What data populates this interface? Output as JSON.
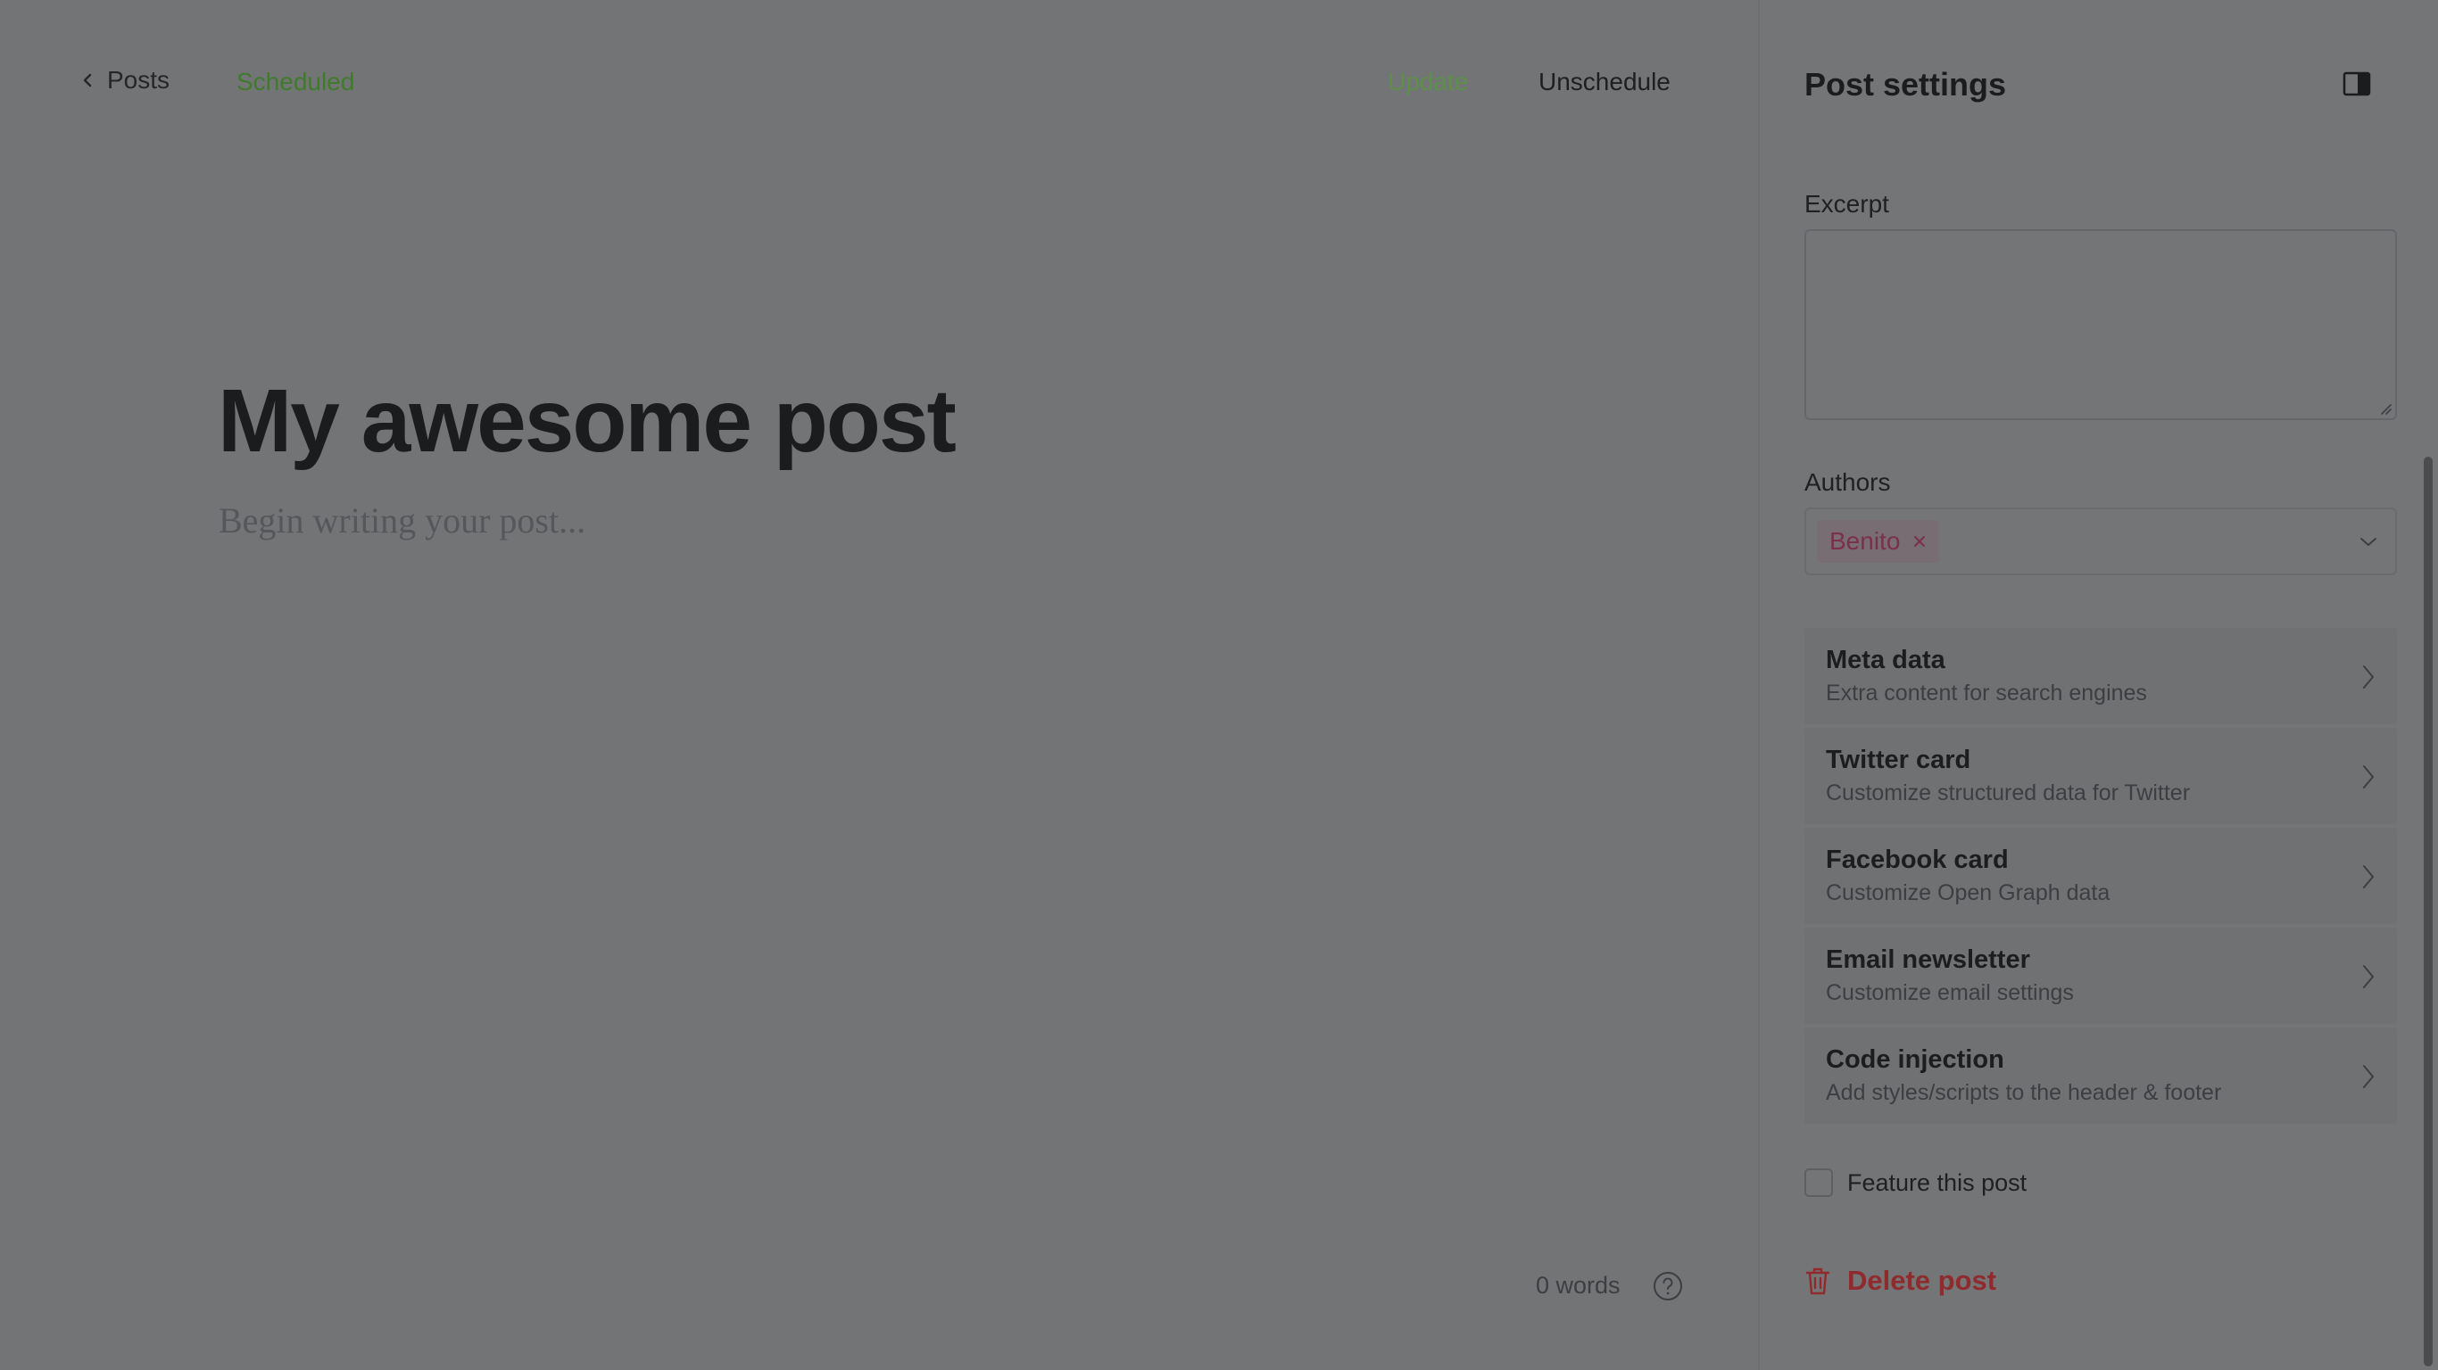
{
  "header": {
    "back_label": "Posts",
    "status": "Scheduled",
    "update_label": "Update",
    "unschedule_label": "Unschedule"
  },
  "editor": {
    "title": "My awesome post",
    "body_placeholder": "Begin writing your post...",
    "word_count": "0 words"
  },
  "settings": {
    "title": "Post settings",
    "excerpt_label": "Excerpt",
    "excerpt_value": "",
    "authors_label": "Authors",
    "authors": [
      "Benito"
    ],
    "items": [
      {
        "title": "Meta data",
        "subtitle": "Extra content for search engines"
      },
      {
        "title": "Twitter card",
        "subtitle": "Customize structured data for Twitter"
      },
      {
        "title": "Facebook card",
        "subtitle": "Customize Open Graph data"
      },
      {
        "title": "Email newsletter",
        "subtitle": "Customize email settings"
      },
      {
        "title": "Code injection",
        "subtitle": "Add styles/scripts to the header & footer"
      }
    ],
    "feature_label": "Feature this post",
    "feature_checked": false,
    "delete_label": "Delete post"
  },
  "colors": {
    "overlay_bg": "#737476",
    "status_green": "#3f7b2b",
    "delete_red": "#8f2a2d",
    "author_tag_text": "#7b2f49"
  }
}
